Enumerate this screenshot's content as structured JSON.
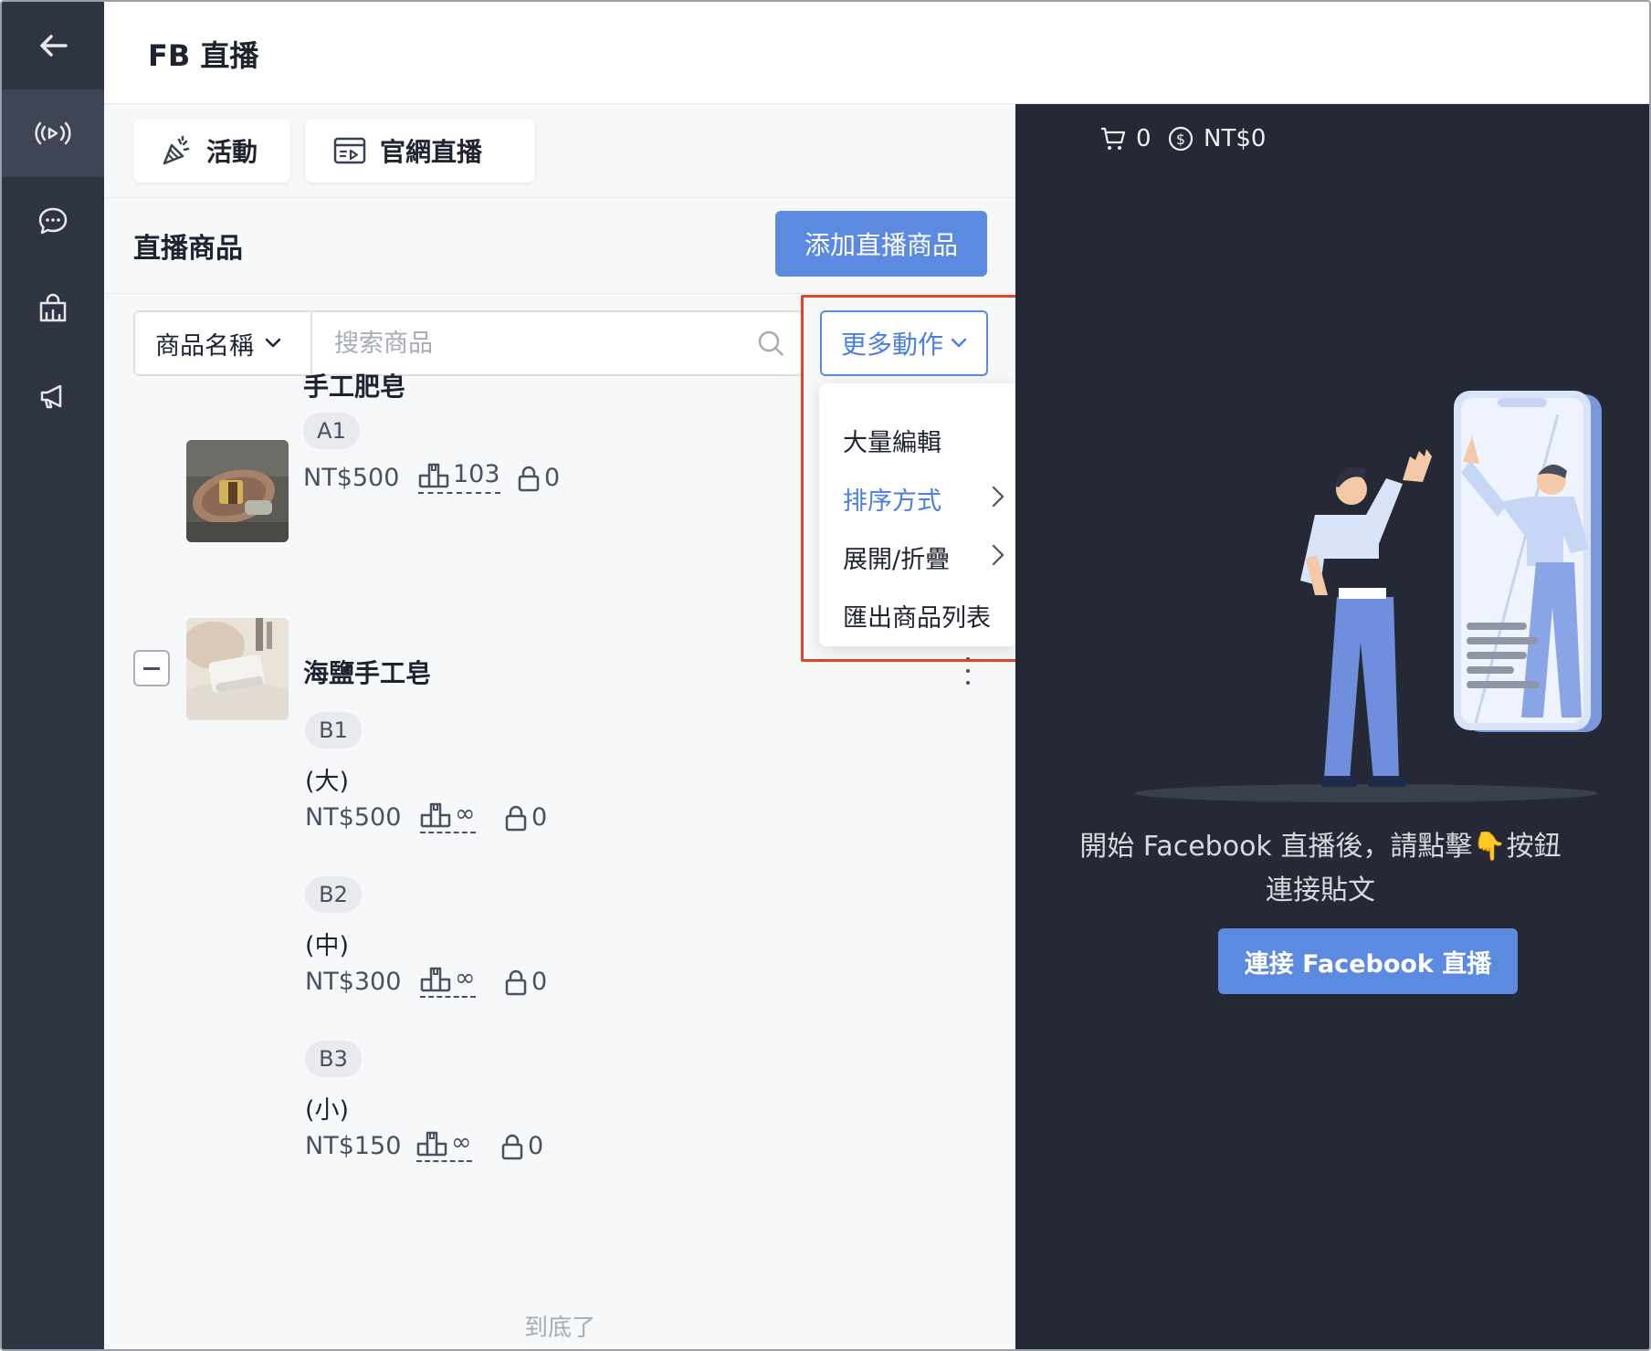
{
  "header": {
    "title": "FB 直播"
  },
  "sidebar": {
    "items": [
      {
        "icon": "back-arrow-icon"
      },
      {
        "icon": "live-broadcast-icon",
        "active": true
      },
      {
        "icon": "chat-bubble-icon"
      },
      {
        "icon": "shop-icon"
      },
      {
        "icon": "megaphone-icon"
      }
    ]
  },
  "tabs": {
    "activity_label": "活動",
    "official_live_label": "官網直播"
  },
  "section": {
    "title": "直播商品",
    "add_button_label": "添加直播商品"
  },
  "filter": {
    "select_value": "商品名稱",
    "search_placeholder": "搜索商品",
    "more_actions_label": "更多動作"
  },
  "more_menu": {
    "items": [
      {
        "label": "大量編輯"
      },
      {
        "label": "排序方式",
        "active": true,
        "submenu": true
      },
      {
        "label": "展開/折疊",
        "submenu": true
      },
      {
        "label": "匯出商品列表"
      }
    ]
  },
  "products": [
    {
      "name": "手工肥皂",
      "sku": "A1",
      "price": "NT$500",
      "stock": "103",
      "locked": "0"
    },
    {
      "name": "海鹽手工皂",
      "variants": [
        {
          "sku": "B1",
          "name": "(大)",
          "price": "NT$500",
          "stock": "∞",
          "locked": "0"
        },
        {
          "sku": "B2",
          "name": "(中)",
          "price": "NT$300",
          "stock": "∞",
          "locked": "0"
        },
        {
          "sku": "B3",
          "name": "(小)",
          "price": "NT$150",
          "stock": "∞",
          "locked": "0"
        }
      ]
    }
  ],
  "list_end_text": "到底了",
  "live_panel": {
    "cart_count": "0",
    "total_amount": "NT$0",
    "hint_line1": "開始 Facebook 直播後，請點擊👇按鈕",
    "hint_line2": "連接貼文",
    "connect_button_label": "連接 Facebook 直播",
    "colors": {
      "accent": "#5b8ae0",
      "panel_bg": "#252935",
      "highlight_border": "#e0452c"
    }
  }
}
